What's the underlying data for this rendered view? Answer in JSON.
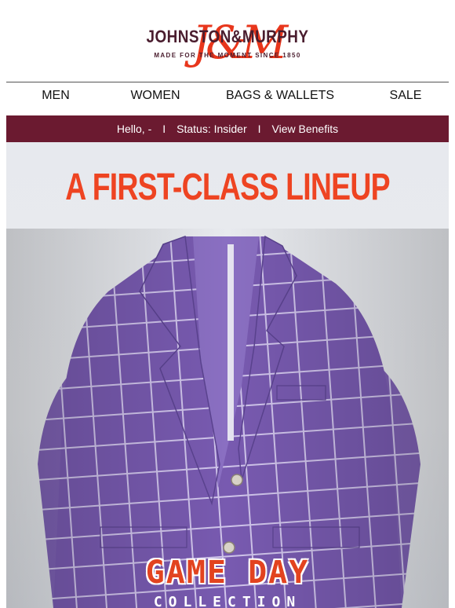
{
  "brand": {
    "name": "JOHNSTON&MURPHY",
    "monogram": "J&M",
    "tagline": "MADE FOR THE MOMENT SINCE 1850"
  },
  "nav": {
    "items": [
      {
        "label": "MEN"
      },
      {
        "label": "WOMEN"
      },
      {
        "label": "BAGS & WALLETS"
      },
      {
        "label": "SALE"
      }
    ]
  },
  "banner": {
    "greeting": "Hello, -",
    "separator": "I",
    "status": "Status: Insider",
    "benefits": "View Benefits"
  },
  "hero": {
    "headline": "A FIRST-CLASS LINEUP",
    "badge_title": "GAME DAY",
    "badge_subtitle": "COLLECTION",
    "product_icon": "plaid-blazer-image"
  },
  "colors": {
    "brand_maroon": "#6b1a30",
    "accent_red": "#ee4422",
    "jacket_purple": "#7a5bb0"
  }
}
